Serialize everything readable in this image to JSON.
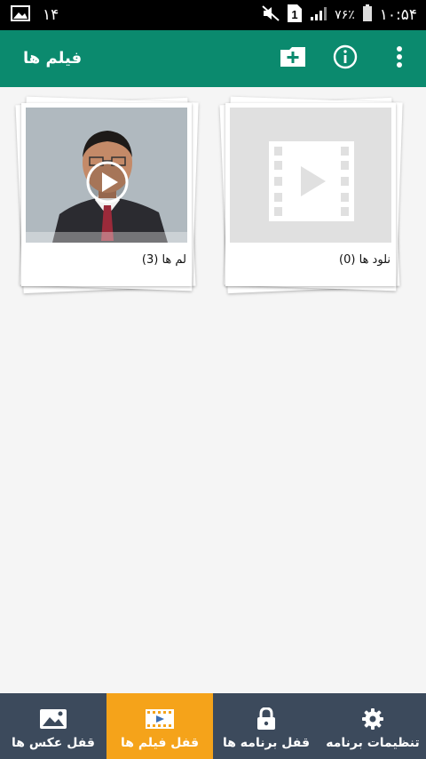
{
  "status_bar": {
    "notification_count": "۱۴",
    "battery_percent": "٧۶٪",
    "sim_label": "1",
    "time": "۱۰:۵۴"
  },
  "app_bar": {
    "title": "فیلم ها"
  },
  "albums": [
    {
      "label": "لم ها (3)"
    },
    {
      "label": "نلود ها (0)"
    }
  ],
  "bottom_nav": {
    "items": [
      {
        "label": "قفل عکس ها",
        "icon": "image-icon"
      },
      {
        "label": "قفل فیلم ها",
        "icon": "film-icon",
        "active": true
      },
      {
        "label": "قفل برنامه ها",
        "icon": "lock-icon"
      },
      {
        "label": "تنظیمات برنامه",
        "icon": "gear-icon"
      }
    ]
  },
  "colors": {
    "app_bar": "#0b8a6e",
    "bottom_nav": "#3c4a5c",
    "active_tab": "#f5a31a"
  }
}
